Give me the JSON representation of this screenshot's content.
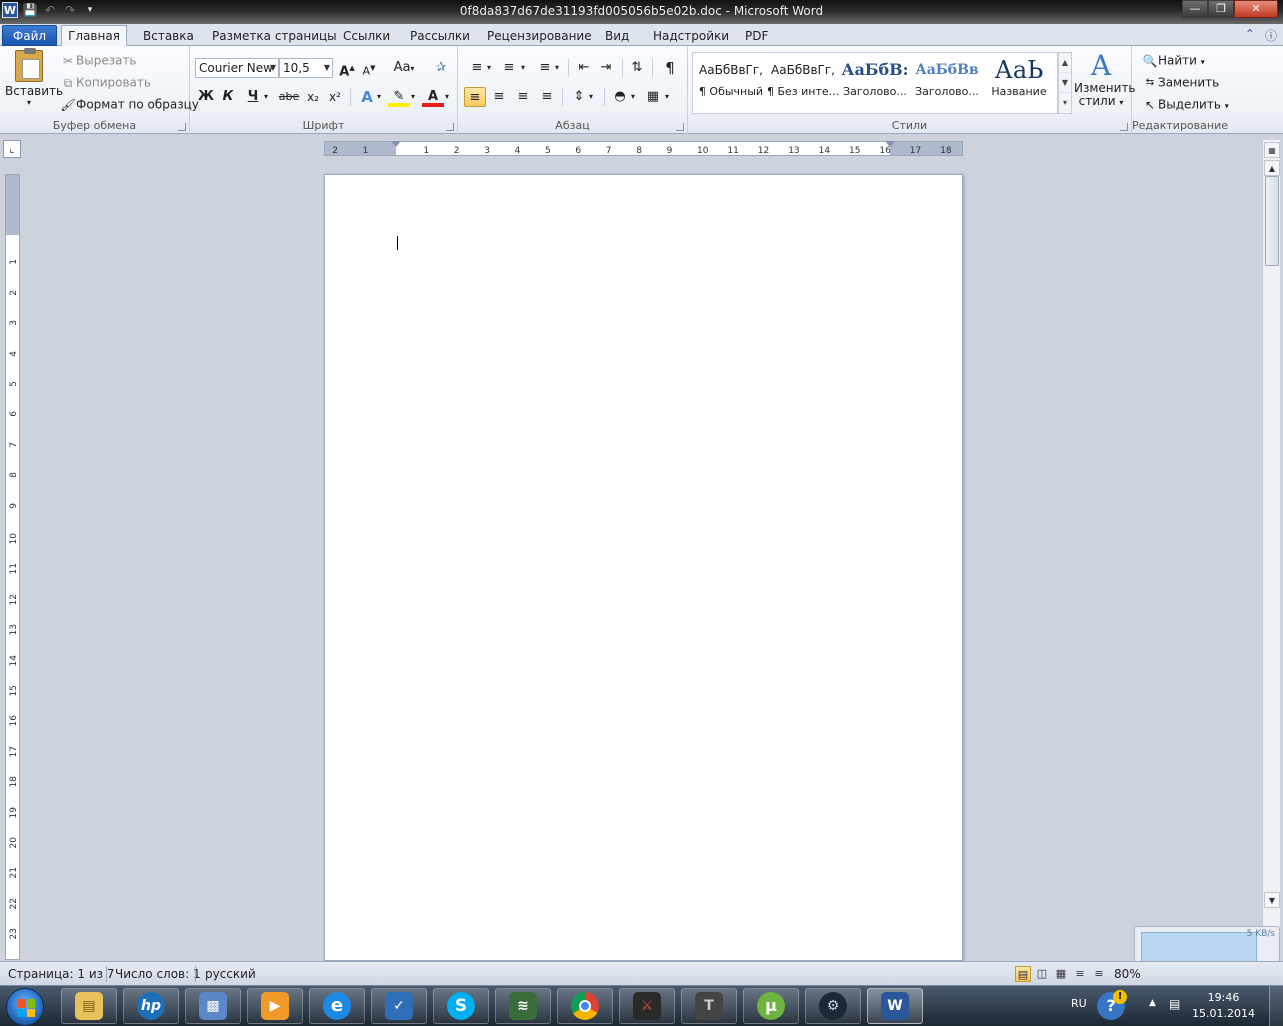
{
  "window": {
    "title": "0f8da837d67de31193fd005056b5e02b.doc - Microsoft Word",
    "app_logo_letter": "W"
  },
  "tabs": {
    "file": "Файл",
    "items": [
      "Главная",
      "Вставка",
      "Разметка страницы",
      "Ссылки",
      "Рассылки",
      "Рецензирование",
      "Вид",
      "Надстройки",
      "PDF"
    ],
    "active_index": 0
  },
  "ribbon": {
    "clipboard": {
      "label": "Буфер обмена",
      "paste": "Вставить",
      "cut": "Вырезать",
      "copy": "Копировать",
      "format_painter": "Формат по образцу"
    },
    "font": {
      "label": "Шрифт",
      "font_name": "Courier New",
      "font_size": "10,5",
      "bold": "Ж",
      "italic": "К",
      "underline": "Ч",
      "strike": "abe",
      "subscript": "x₂",
      "superscript": "x²",
      "grow": "A",
      "shrink": "A",
      "change_case": "Aa"
    },
    "paragraph": {
      "label": "Абзац",
      "pilcrow": "¶"
    },
    "styles": {
      "label": "Стили",
      "items": [
        {
          "preview": "АаБбВвГг,",
          "name": "¶ Обычный"
        },
        {
          "preview": "АаБбВвГг,",
          "name": "¶ Без инте..."
        },
        {
          "preview": "АаБбВ:",
          "name": "Заголово..."
        },
        {
          "preview": "АаБбВв",
          "name": "Заголово..."
        },
        {
          "preview": "АаЬ",
          "name": "Название"
        }
      ],
      "change_styles_line1": "Изменить",
      "change_styles_line2": "стили"
    },
    "editing": {
      "label": "Редактирование",
      "find": "Найти",
      "replace": "Заменить",
      "select": "Выделить"
    }
  },
  "ruler": {
    "h_left_ticks": [
      "2",
      "1"
    ],
    "h_ticks": [
      "1",
      "2",
      "3",
      "4",
      "5",
      "6",
      "7",
      "8",
      "9",
      "10",
      "11",
      "12",
      "13",
      "14",
      "15",
      "16",
      "17",
      "18"
    ],
    "v_ticks": [
      "1",
      "2",
      "3",
      "4",
      "5",
      "6",
      "7",
      "8",
      "9",
      "10",
      "11",
      "12",
      "13",
      "14",
      "15",
      "16",
      "17",
      "18",
      "19",
      "20",
      "21",
      "22",
      "23"
    ]
  },
  "statusbar": {
    "page": "Страница: 1 из 7",
    "words": "Число слов: 1",
    "language": "русский",
    "zoom": "80%"
  },
  "network_widget": {
    "rate": "5 KB/s"
  },
  "taskbar": {
    "apps": [
      "file-explorer",
      "hp",
      "remote-desktop",
      "media-player",
      "internet-explorer",
      "task-app",
      "skype",
      "system-monitor",
      "chrome",
      "game-app",
      "world-of-tanks",
      "utorrent",
      "steam",
      "word"
    ],
    "language": "RU",
    "time": "19:46",
    "date": "15.01.2014"
  },
  "colors": {
    "accent": "#2b579a",
    "file_tab": "#1a56b0",
    "highlight_active": "#f8c957"
  }
}
